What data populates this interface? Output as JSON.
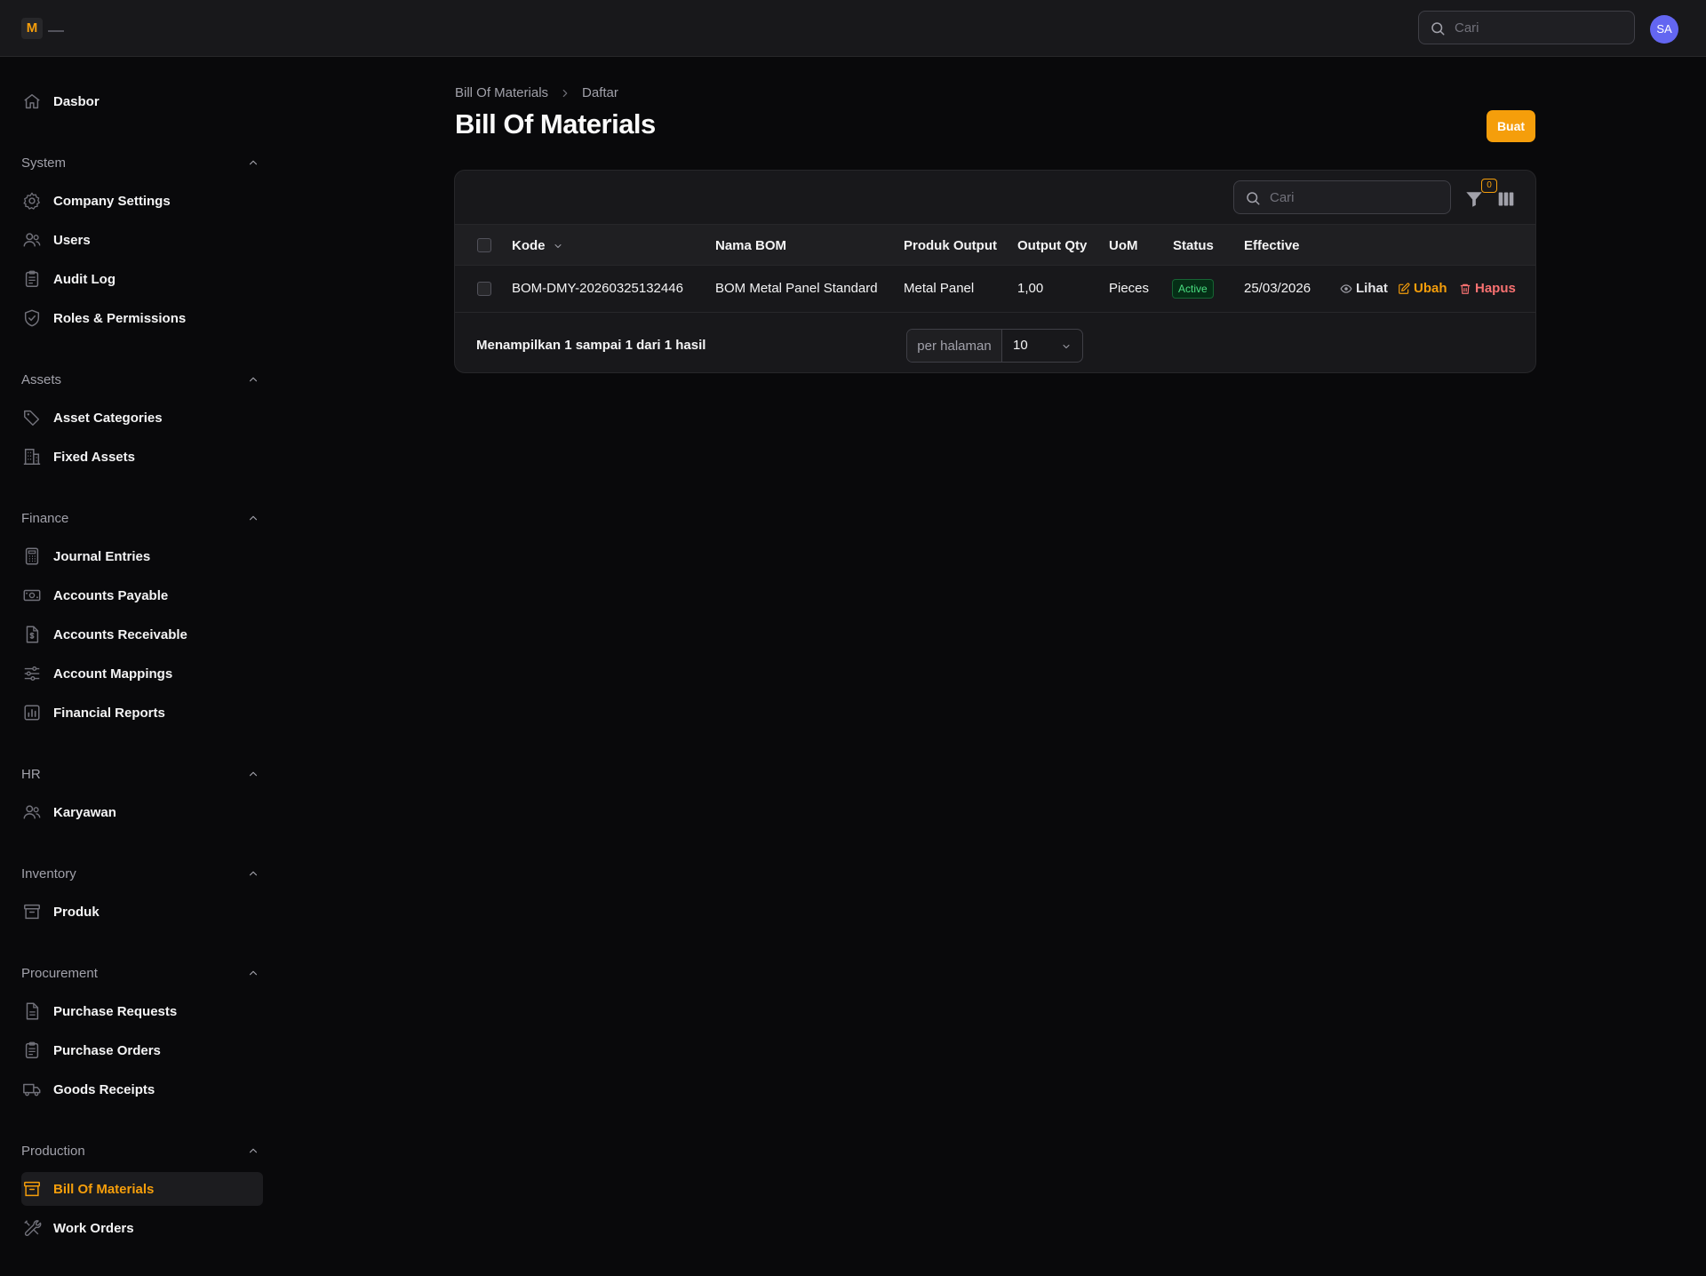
{
  "app": {
    "logo_letter": "M",
    "search_placeholder": "Cari",
    "user_initials": "SA",
    "accent_color": "#f59e0b",
    "avatar_color": "#6366f1"
  },
  "sidebar": {
    "dashboard": {
      "label": "Dasbor",
      "icon": "home-icon"
    },
    "groups": [
      {
        "name": "System",
        "items": [
          {
            "label": "Company Settings",
            "icon": "gear-icon"
          },
          {
            "label": "Users",
            "icon": "users-icon"
          },
          {
            "label": "Audit Log",
            "icon": "clipboard-icon"
          },
          {
            "label": "Roles & Permissions",
            "icon": "shield-icon"
          }
        ]
      },
      {
        "name": "Assets",
        "items": [
          {
            "label": "Asset Categories",
            "icon": "tag-icon"
          },
          {
            "label": "Fixed Assets",
            "icon": "building-icon"
          }
        ]
      },
      {
        "name": "Finance",
        "items": [
          {
            "label": "Journal Entries",
            "icon": "calculator-icon"
          },
          {
            "label": "Accounts Payable",
            "icon": "banknote-icon"
          },
          {
            "label": "Accounts Receivable",
            "icon": "dollar-document-icon"
          },
          {
            "label": "Account Mappings",
            "icon": "sliders-icon"
          },
          {
            "label": "Financial Reports",
            "icon": "bar-chart-icon"
          }
        ]
      },
      {
        "name": "HR",
        "items": [
          {
            "label": "Karyawan",
            "icon": "users-icon"
          }
        ]
      },
      {
        "name": "Inventory",
        "items": [
          {
            "label": "Produk",
            "icon": "archive-box-icon"
          }
        ]
      },
      {
        "name": "Procurement",
        "items": [
          {
            "label": "Purchase Requests",
            "icon": "document-icon"
          },
          {
            "label": "Purchase Orders",
            "icon": "clipboard-icon"
          },
          {
            "label": "Goods Receipts",
            "icon": "truck-icon"
          }
        ]
      },
      {
        "name": "Production",
        "items": [
          {
            "label": "Bill Of Materials",
            "icon": "archive-box-icon",
            "active": true
          },
          {
            "label": "Work Orders",
            "icon": "wrench-icon"
          }
        ]
      }
    ]
  },
  "page": {
    "breadcrumb": [
      "Bill Of Materials",
      "Daftar"
    ],
    "title": "Bill Of Materials",
    "create_label": "Buat"
  },
  "table": {
    "search_placeholder": "Cari",
    "filter_count": "0",
    "columns": [
      "Kode",
      "Nama BOM",
      "Produk Output",
      "Output Qty",
      "UoM",
      "Status",
      "Effective"
    ],
    "rows": [
      {
        "kode": "BOM-DMY-20260325132446",
        "nama_bom": "BOM Metal Panel Standard",
        "produk_output": "Metal Panel",
        "output_qty": "1,00",
        "uom": "Pieces",
        "status": "Active",
        "effective": "25/03/2026",
        "actions": {
          "view": "Lihat",
          "edit": "Ubah",
          "delete": "Hapus"
        }
      }
    ],
    "footer": {
      "summary": "Menampilkan 1 sampai 1 dari 1 hasil",
      "per_page_label": "per halaman",
      "per_page_value": "10"
    }
  }
}
